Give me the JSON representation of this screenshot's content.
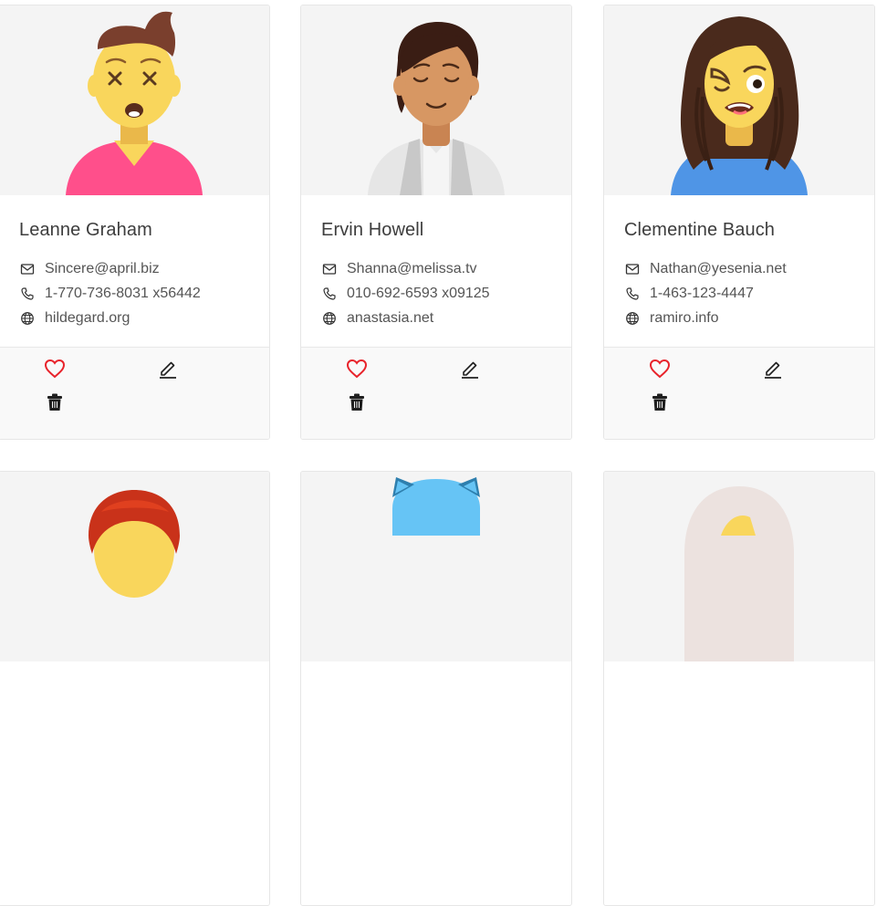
{
  "users": [
    {
      "name": "Leanne Graham",
      "email": "Sincere@april.biz",
      "phone": "1-770-736-8031 x56442",
      "website": "hildegard.org",
      "avatar": "avatar-icon"
    },
    {
      "name": "Ervin Howell",
      "email": "Shanna@melissa.tv",
      "phone": "010-692-6593 x09125",
      "website": "anastasia.net",
      "avatar": "avatar-icon"
    },
    {
      "name": "Clementine Bauch",
      "email": "Nathan@yesenia.net",
      "phone": "1-463-123-4447",
      "website": "ramiro.info",
      "avatar": "avatar-icon"
    }
  ],
  "icons": {
    "email": "mail-icon",
    "phone": "phone-icon",
    "website": "globe-icon",
    "like": "heart-icon",
    "edit": "edit-icon",
    "delete": "trash-icon"
  },
  "colors": {
    "like": "#e8232b",
    "accent": "#1f1f1f",
    "card_border": "#e6e6e6",
    "avatar_bg": "#f4f4f4",
    "actions_bg": "#f9f9f9"
  }
}
